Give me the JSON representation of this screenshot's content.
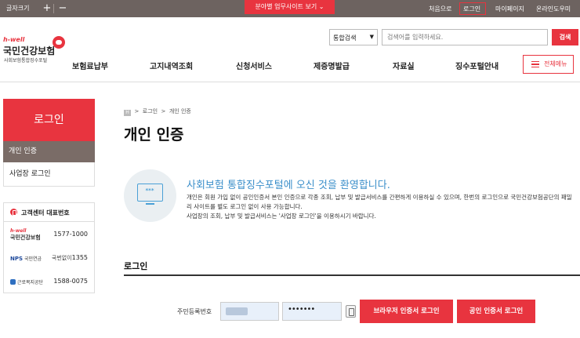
{
  "topbar": {
    "font_size_label": "글자크기",
    "plus": "+",
    "minus": "−",
    "site_button": "분야별 업무사이트 보기",
    "links": [
      "처음으로",
      "로그인",
      "마이페이지",
      "온라인도우미"
    ]
  },
  "logo": {
    "hwell": "h-well",
    "name": "국민건강보험",
    "sub": "사회보험통합징수포털"
  },
  "search": {
    "select_value": "통합검색",
    "placeholder": "검색어를 입력하세요.",
    "button": "검색"
  },
  "gnb": {
    "items": [
      "보험료납부",
      "고지내역조회",
      "신청서비스",
      "제증명발급",
      "자료실",
      "징수포털안내"
    ],
    "all_menu": "전체메뉴"
  },
  "lnb": {
    "title": "로그인",
    "items": [
      "개인 인증",
      "사업장 로그인"
    ]
  },
  "contact": {
    "title": "고객센터 대표번호",
    "rows": [
      {
        "org_brand": "h-well",
        "org": "국민건강보험",
        "number": "1577-1000",
        "prefix": ""
      },
      {
        "org_brand": "NPS",
        "org": "국민연금",
        "number": "1355",
        "prefix": "국번없이"
      },
      {
        "org_brand": "",
        "org": "근로복지공단",
        "number": "1588-0075",
        "prefix": ""
      }
    ]
  },
  "breadcrumb": {
    "home": "H",
    "items": [
      "로그인",
      "개인 인증"
    ]
  },
  "page_title": "개인 인증",
  "welcome": {
    "icon_text": "***",
    "title": "사회보험 통합징수포털에 오신 것을 환영합니다.",
    "desc1": "개인은 회원 가입 없이 공인인증서 본인 인증으로 각종 조회, 납부 및 발급서비스를 간편하게 이용하실 수 있으며, 한번의 로그인으로 국민건강보험공단의 패밀리 사이트를 별도 로그인 없이 사용 가능합니다.",
    "desc2": "사업장의 조회, 납부 및 발급서비스는 '사업장 로그인'을 이용하시기 바랍니다."
  },
  "login": {
    "section_title": "로그인",
    "rrn_label": "주민등록번호",
    "rrn_back_value": "•••••••",
    "browser_cert_button": "브라우저 인증서 로그인",
    "public_cert_button": "공인 인증서 로그인"
  },
  "colors": {
    "accent": "#e8343f",
    "topbar": "#6d6360",
    "lnb_active": "#7a6c67",
    "welcome_blue": "#3b8fca"
  }
}
